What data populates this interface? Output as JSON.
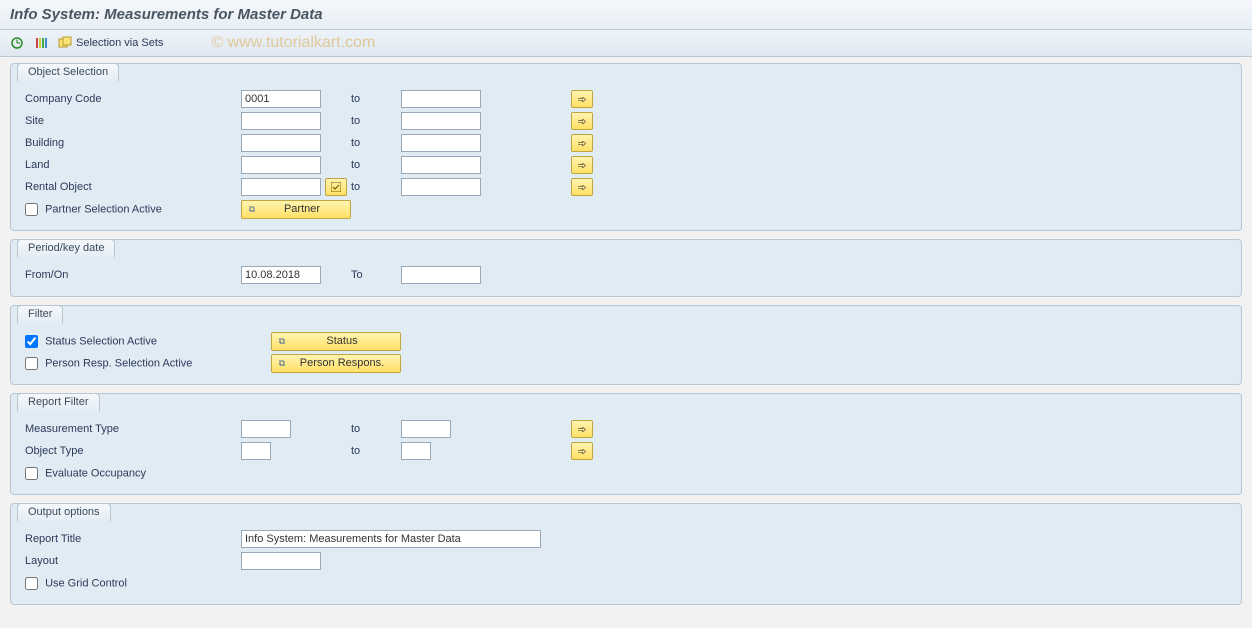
{
  "header": {
    "title": "Info System: Measurements for Master Data"
  },
  "watermark": "© www.tutorialkart.com",
  "toolbar": {
    "selection_via_sets": "Selection via Sets"
  },
  "groups": {
    "object_selection": {
      "title": "Object Selection",
      "company_code": {
        "label": "Company Code",
        "from": "0001",
        "to_label": "to",
        "to": ""
      },
      "site": {
        "label": "Site",
        "from": "",
        "to_label": "to",
        "to": ""
      },
      "building": {
        "label": "Building",
        "from": "",
        "to_label": "to",
        "to": ""
      },
      "land": {
        "label": "Land",
        "from": "",
        "to_label": "to",
        "to": ""
      },
      "rental_object": {
        "label": "Rental Object",
        "from": "",
        "to_label": "to",
        "to": ""
      },
      "partner_selection": {
        "label": "Partner Selection Active",
        "checked": false
      },
      "partner_button": "Partner"
    },
    "period": {
      "title": "Period/key date",
      "from_on": {
        "label": "From/On",
        "value": "10.08.2018",
        "to_label": "To",
        "to": ""
      }
    },
    "filter": {
      "title": "Filter",
      "status_selection": {
        "label": "Status Selection Active",
        "checked": true
      },
      "status_button": "Status",
      "person_selection": {
        "label": "Person Resp. Selection Active",
        "checked": false
      },
      "person_button": "Person Respons."
    },
    "report_filter": {
      "title": "Report Filter",
      "measurement_type": {
        "label": "Measurement Type",
        "from": "",
        "to_label": "to",
        "to": ""
      },
      "object_type": {
        "label": "Object Type",
        "from": "",
        "to_label": "to",
        "to": ""
      },
      "evaluate_occupancy": {
        "label": "Evaluate Occupancy",
        "checked": false
      }
    },
    "output": {
      "title": "Output options",
      "report_title": {
        "label": "Report Title",
        "value": "Info System: Measurements for Master Data"
      },
      "layout": {
        "label": "Layout",
        "value": ""
      },
      "use_grid": {
        "label": "Use Grid Control",
        "checked": false
      }
    }
  }
}
